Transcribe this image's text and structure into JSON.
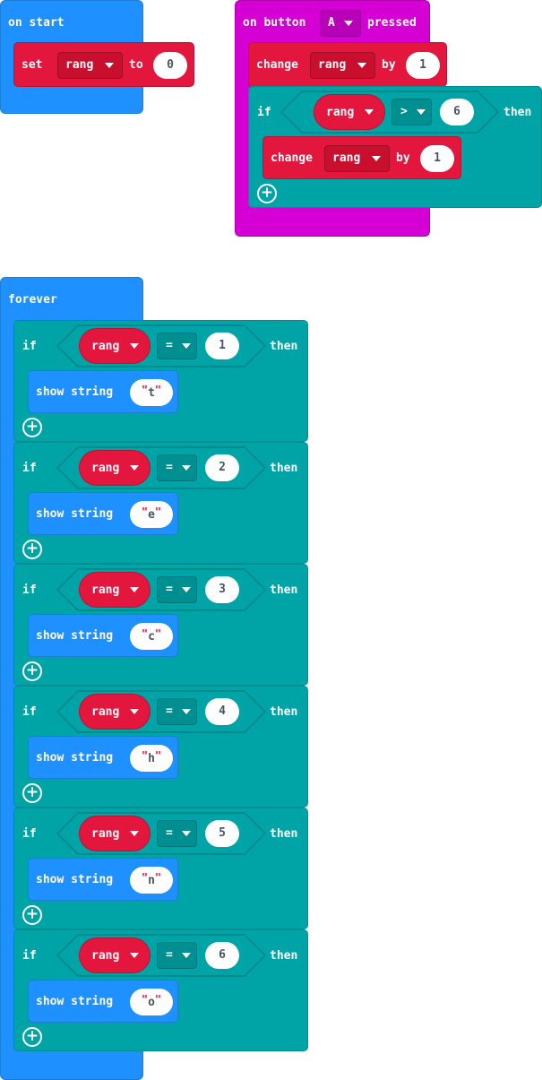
{
  "on_start": {
    "title": "on start",
    "set_label": "set",
    "variable": "rang",
    "to_label": "to",
    "value": "0"
  },
  "on_button": {
    "on_label": "on button",
    "button": "A",
    "pressed_label": "pressed",
    "change1": {
      "label": "change",
      "variable": "rang",
      "by_label": "by",
      "value": "1"
    },
    "if_block": {
      "if_label": "if",
      "variable": "rang",
      "operator": ">",
      "value": "6",
      "then_label": "then",
      "change": {
        "label": "change",
        "variable": "rang",
        "by_label": "by",
        "value": "1"
      }
    }
  },
  "forever": {
    "title": "forever",
    "blocks": [
      {
        "if_label": "if",
        "variable": "rang",
        "operator": "=",
        "value": "1",
        "then_label": "then",
        "show_label": "show string",
        "string": "t"
      },
      {
        "if_label": "if",
        "variable": "rang",
        "operator": "=",
        "value": "2",
        "then_label": "then",
        "show_label": "show string",
        "string": "e"
      },
      {
        "if_label": "if",
        "variable": "rang",
        "operator": "=",
        "value": "3",
        "then_label": "then",
        "show_label": "show string",
        "string": "c"
      },
      {
        "if_label": "if",
        "variable": "rang",
        "operator": "=",
        "value": "4",
        "then_label": "then",
        "show_label": "show string",
        "string": "h"
      },
      {
        "if_label": "if",
        "variable": "rang",
        "operator": "=",
        "value": "5",
        "then_label": "then",
        "show_label": "show string",
        "string": "n"
      },
      {
        "if_label": "if",
        "variable": "rang",
        "operator": "=",
        "value": "6",
        "then_label": "then",
        "show_label": "show string",
        "string": "o"
      }
    ]
  },
  "colors": {
    "basic_blue": "#1e90ff",
    "input_magenta": "#d400d4",
    "variables_red": "#e3173d",
    "logic_teal": "#00a4a6"
  },
  "icons": {
    "add": "plus-circle-icon",
    "dropdown": "caret-down-icon"
  }
}
